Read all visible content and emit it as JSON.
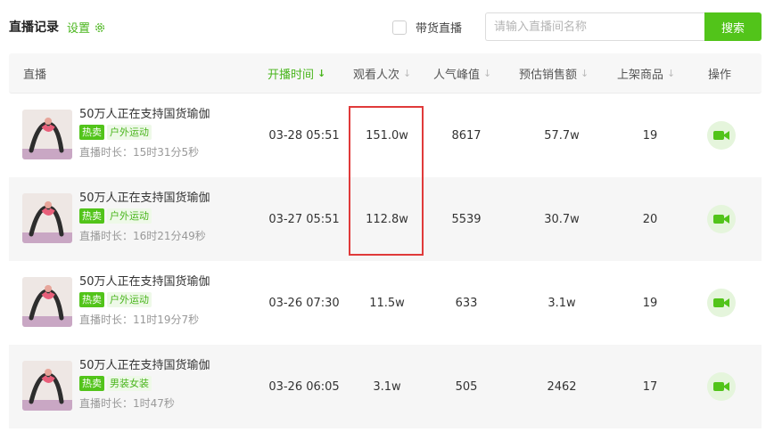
{
  "header": {
    "title": "直播记录",
    "settings_label": "设置",
    "filter_label": "带货直播",
    "search_placeholder": "请输入直播间名称",
    "search_button": "搜索"
  },
  "table": {
    "columns": {
      "live": "直播",
      "start_time": "开播时间",
      "views": "观看人次",
      "peak": "人气峰值",
      "est_sales": "预估销售额",
      "goods": "上架商品",
      "action": "操作"
    },
    "rows": [
      {
        "title": "50万人正在支持国货瑜伽",
        "hot": "热卖",
        "category": "户外运动",
        "duration": "直播时长：15时31分5秒",
        "start_time": "03-28 05:51",
        "views": "151.0w",
        "peak": "8617",
        "est_sales": "57.7w",
        "goods": "19"
      },
      {
        "title": "50万人正在支持国货瑜伽",
        "hot": "热卖",
        "category": "户外运动",
        "duration": "直播时长：16时21分49秒",
        "start_time": "03-27 05:51",
        "views": "112.8w",
        "peak": "5539",
        "est_sales": "30.7w",
        "goods": "20"
      },
      {
        "title": "50万人正在支持国货瑜伽",
        "hot": "热卖",
        "category": "户外运动",
        "duration": "直播时长：11时19分7秒",
        "start_time": "03-26 07:30",
        "views": "11.5w",
        "peak": "633",
        "est_sales": "3.1w",
        "goods": "19"
      },
      {
        "title": "50万人正在支持国货瑜伽",
        "hot": "热卖",
        "category": "男装女装",
        "duration": "直播时长：1时47秒",
        "start_time": "03-26 06:05",
        "views": "3.1w",
        "peak": "505",
        "est_sales": "2462",
        "goods": "17"
      }
    ]
  },
  "colors": {
    "accent": "#52c41a",
    "highlight_box": "#e03a3a"
  },
  "icons": {
    "settings": "gear-icon",
    "sort": "sort-arrow-icon",
    "action": "video-camera-icon"
  }
}
